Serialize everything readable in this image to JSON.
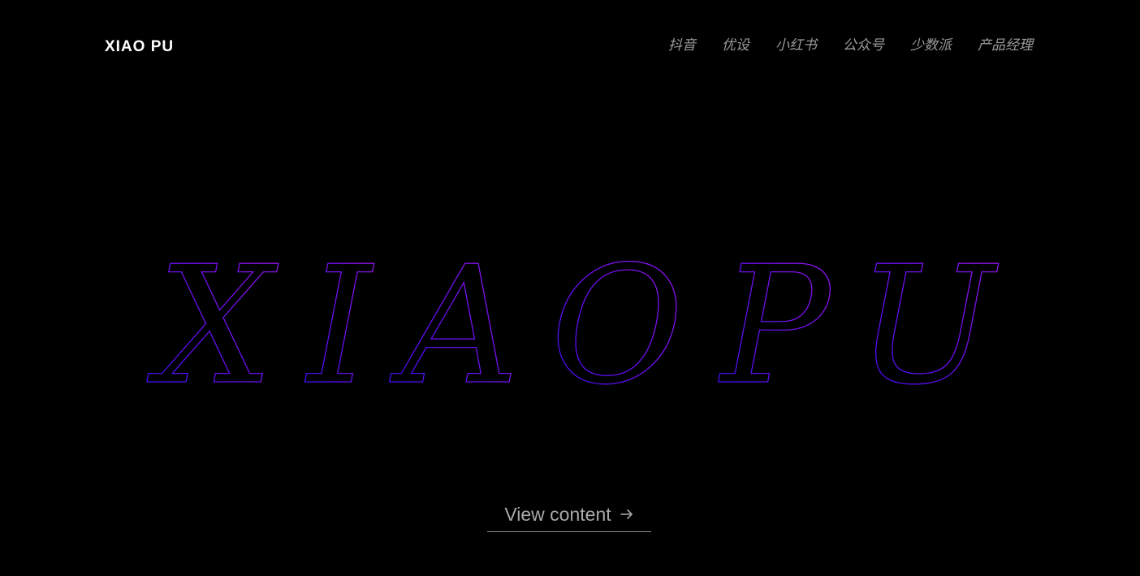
{
  "header": {
    "logo": "XIAO PU",
    "nav": [
      {
        "label": "抖音"
      },
      {
        "label": "优设"
      },
      {
        "label": "小红书"
      },
      {
        "label": "公众号"
      },
      {
        "label": "少数派"
      },
      {
        "label": "产品经理"
      }
    ]
  },
  "hero": {
    "letters": [
      "X",
      "I",
      "A",
      "O",
      "P",
      "U"
    ],
    "gradient_start": "#3a0cf5",
    "gradient_end": "#9a12e8"
  },
  "cta": {
    "label": "View content",
    "icon": "arrow-right-icon"
  },
  "colors": {
    "background": "#000000",
    "logo": "#ffffff",
    "nav_text": "#9a9a9a",
    "cta_text": "#a8a8a8"
  }
}
